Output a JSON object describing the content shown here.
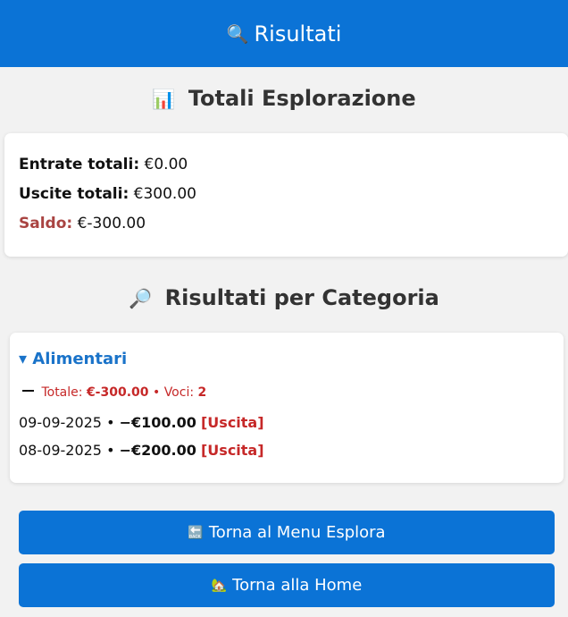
{
  "header": {
    "title": "Risultati",
    "icon": "🔍"
  },
  "totals": {
    "title": "Totali Esplorazione",
    "icon": "📊",
    "entrate_label": "Entrate totali:",
    "entrate_value": "€0.00",
    "uscite_label": "Uscite totali:",
    "uscite_value": "€300.00",
    "saldo_label": "Saldo:",
    "saldo_value": "€-300.00"
  },
  "categories": {
    "title": "Risultati per Categoria",
    "icon": "🔎",
    "items": [
      {
        "name": "▾ Alimentari",
        "total_label": "Totale:",
        "total_value": "€-300.00",
        "sep": "•",
        "count_label": "Voci:",
        "count_value": "2",
        "entries": [
          {
            "date": "09-09-2025",
            "sep": "•",
            "amount": "−€100.00",
            "type": "[Uscita]"
          },
          {
            "date": "08-09-2025",
            "sep": "•",
            "amount": "−€200.00",
            "type": "[Uscita]"
          }
        ]
      }
    ]
  },
  "buttons": {
    "explore_label": "Torna al Menu Esplora",
    "explore_icon": "🔙",
    "home_label": "Torna alla Home",
    "home_icon": "🏡"
  },
  "colors": {
    "primary": "#0b73d6",
    "negative": "#c62828",
    "saldo": "#a94442",
    "category": "#1a73c9"
  }
}
